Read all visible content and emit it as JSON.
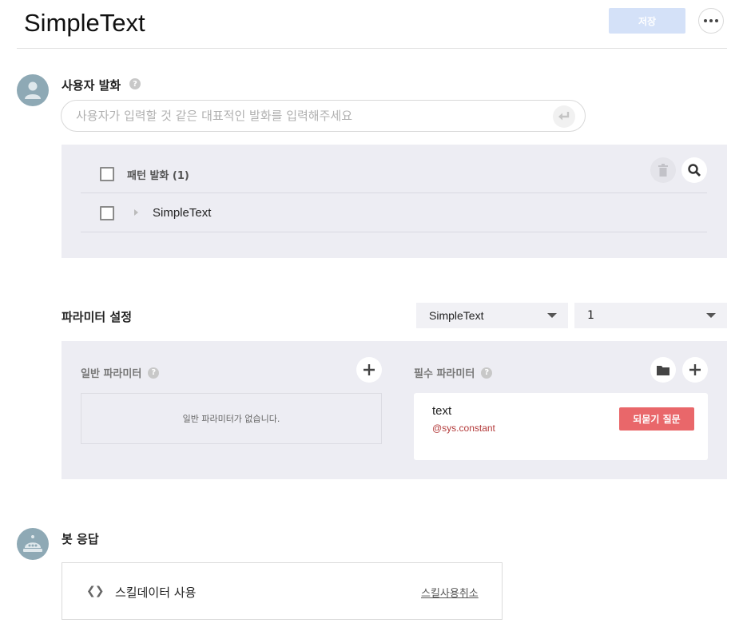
{
  "header": {
    "title": "SimpleText",
    "save_label": "저장"
  },
  "user_utterance": {
    "section_title": "사용자 발화",
    "help": "?",
    "input_placeholder": "사용자가 입력할 것 같은 대표적인 발화를 입력해주세요",
    "pattern": {
      "header_label": "패턴 발화 (1)",
      "items": [
        {
          "label": "SimpleText"
        }
      ]
    }
  },
  "parameters": {
    "section_title": "파라미터 설정",
    "select_block": "SimpleText",
    "select_count": "1",
    "general": {
      "title": "일반 파라미터",
      "help": "?",
      "empty_text": "일반 파라미터가 없습니다."
    },
    "required": {
      "title": "필수 파라미터",
      "help": "?",
      "items": [
        {
          "name": "text",
          "entity": "@sys.constant",
          "reprompt_label": "되묻기 질문"
        }
      ]
    }
  },
  "bot_response": {
    "section_title": "봇 응답",
    "skill_label": "스킬데이터 사용",
    "skill_cancel": "스킬사용취소"
  },
  "colors": {
    "save_bg": "#d4e1f8",
    "avatar": "#8ea9b5",
    "panel_bg": "#ededf3",
    "reprompt_bg": "#e9676a",
    "entity_text": "#b33a3a"
  }
}
